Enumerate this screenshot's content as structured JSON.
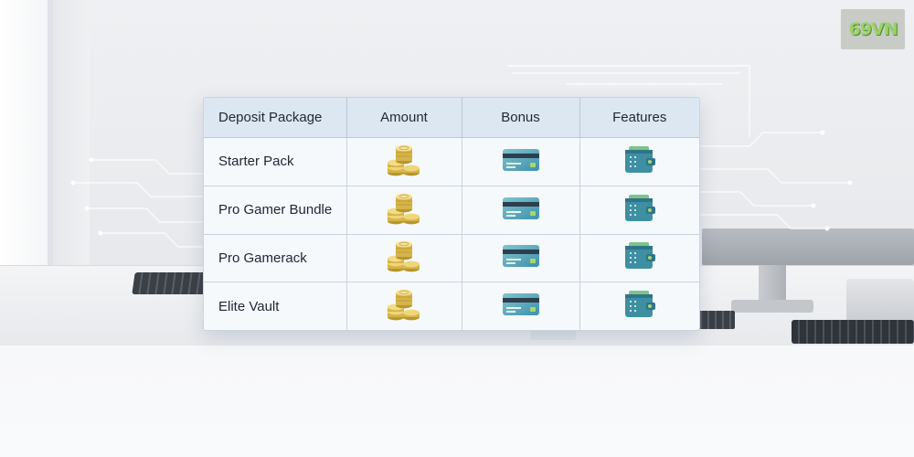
{
  "brand": {
    "logo_text": "69VN"
  },
  "table": {
    "headers": [
      "Deposit Package",
      "Amount",
      "Bonus",
      "Features"
    ],
    "rows": [
      {
        "package": "Starter Pack",
        "amount_icon": "coins-stack-icon",
        "bonus_icon": "credit-card-icon",
        "features_icon": "wallet-icon"
      },
      {
        "package": "Pro Gamer Bundle",
        "amount_icon": "coins-stack-icon",
        "bonus_icon": "credit-card-icon",
        "features_icon": "wallet-icon"
      },
      {
        "package": "Pro Gamerack",
        "amount_icon": "coins-stack-icon",
        "bonus_icon": "credit-card-icon",
        "features_icon": "wallet-icon"
      },
      {
        "package": "Elite Vault",
        "amount_icon": "coins-stack-icon",
        "bonus_icon": "credit-card-icon",
        "features_icon": "wallet-icon"
      }
    ]
  },
  "colors": {
    "header_bg": "#dde7f1",
    "row_bg": "#f6f9fc",
    "coin_gold": "#e2c45e",
    "card_teal": "#4fa6b8",
    "wallet_teal": "#3f8fa3"
  }
}
